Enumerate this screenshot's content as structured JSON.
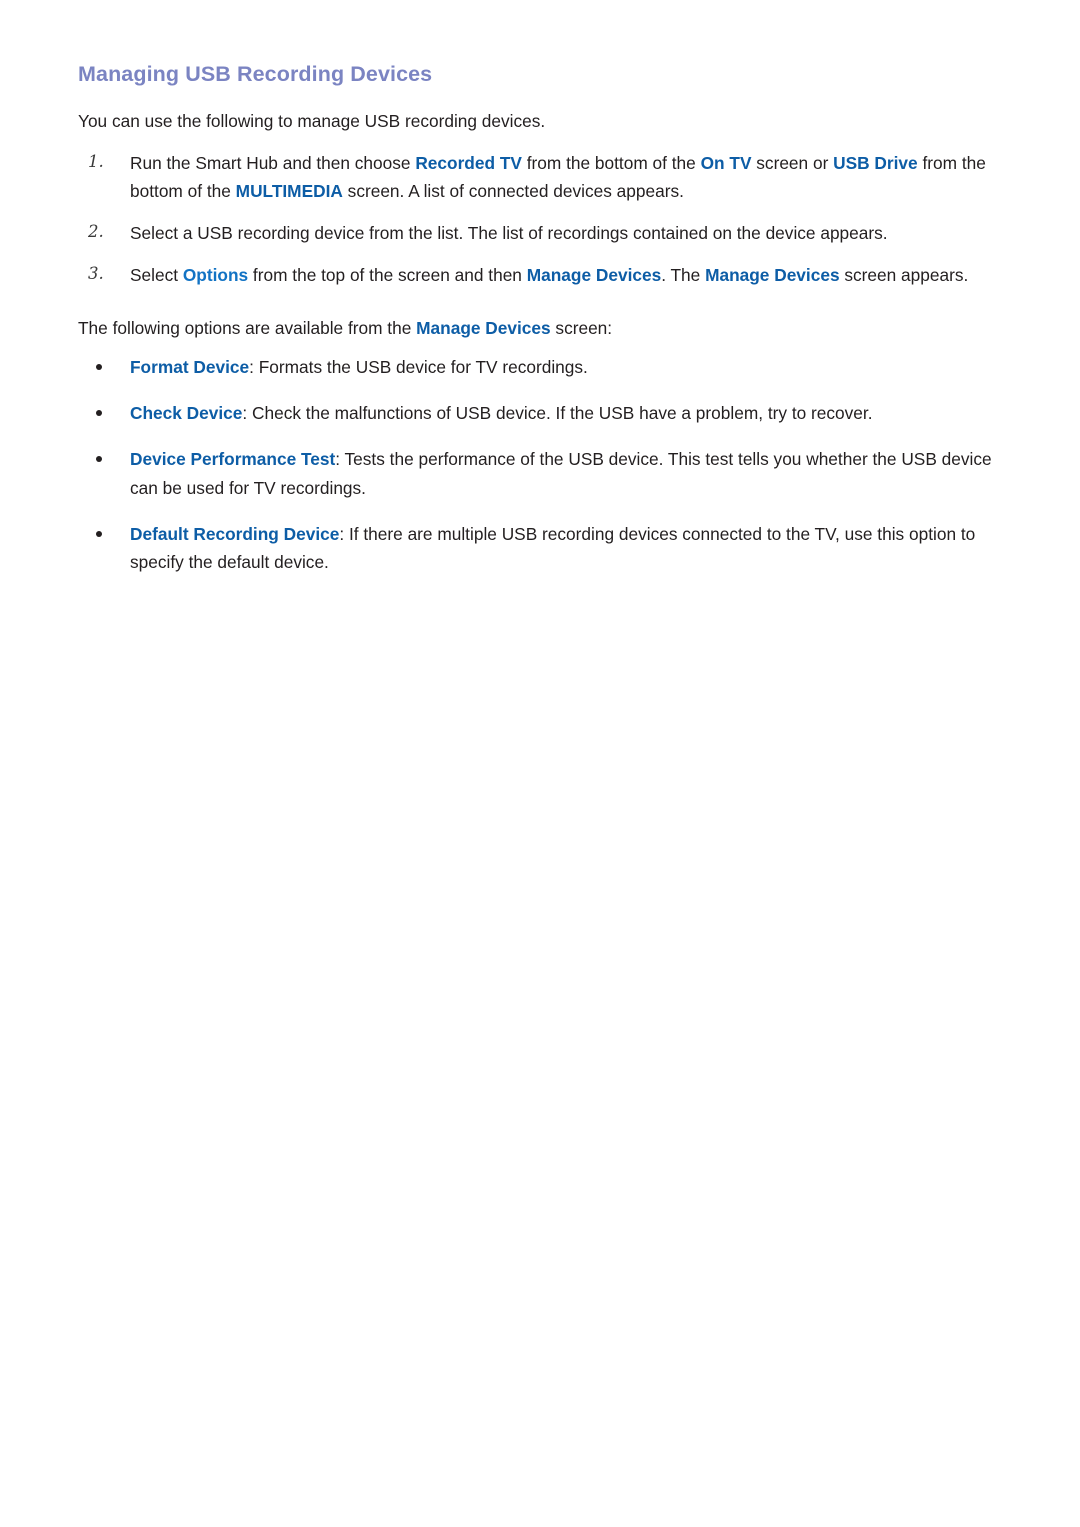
{
  "document": {
    "title": "Managing USB Recording Devices",
    "intro": "You can use the following to manage USB recording devices."
  },
  "steps": [
    {
      "marker": "1.",
      "segments": [
        {
          "text": "Run the Smart Hub and then choose ",
          "style": "plain"
        },
        {
          "text": "Recorded TV",
          "style": "highlight"
        },
        {
          "text": " from the bottom of the ",
          "style": "plain"
        },
        {
          "text": "On TV",
          "style": "highlight"
        },
        {
          "text": " screen or ",
          "style": "plain"
        },
        {
          "text": "USB Drive",
          "style": "highlight"
        },
        {
          "text": " from the bottom of the ",
          "style": "plain"
        },
        {
          "text": "MULTIMEDIA",
          "style": "highlight"
        },
        {
          "text": " screen. A list of connected devices appears.",
          "style": "plain"
        }
      ]
    },
    {
      "marker": "2.",
      "segments": [
        {
          "text": "Select a USB recording device from the list. The list of recordings contained on the device appears.",
          "style": "plain"
        }
      ]
    },
    {
      "marker": "3.",
      "segments": [
        {
          "text": "Select ",
          "style": "plain"
        },
        {
          "text": "Options",
          "style": "highlight-bright"
        },
        {
          "text": " from the top of the screen and then ",
          "style": "plain"
        },
        {
          "text": "Manage Devices",
          "style": "highlight"
        },
        {
          "text": ". The ",
          "style": "plain"
        },
        {
          "text": "Manage Devices",
          "style": "highlight"
        },
        {
          "text": " screen appears.",
          "style": "plain"
        }
      ]
    }
  ],
  "options_section": {
    "lead": [
      {
        "text": "The following options are available from the ",
        "style": "plain"
      },
      {
        "text": "Manage Devices",
        "style": "highlight"
      },
      {
        "text": " screen:",
        "style": "plain"
      }
    ],
    "items": [
      {
        "term": "Format Device",
        "separator": ": ",
        "description": "Formats the USB device for TV recordings."
      },
      {
        "term": "Check Device",
        "separator": ": ",
        "description": "Check the malfunctions of USB device. If the USB have a problem, try to recover."
      },
      {
        "term": "Device Performance Test",
        "separator": ": ",
        "description": "Tests the performance of the USB device. This test tells you whether the USB device can be used for TV recordings."
      },
      {
        "term": "Default Recording Device",
        "separator": ": ",
        "description": "If there are multiple USB recording devices connected to the TV, use this option to specify the default device."
      }
    ]
  },
  "colors": {
    "title": "#7b84c2",
    "highlight": "#0d5da6",
    "highlight_bright": "#1273c4",
    "body_text": "#231f20",
    "page_background": "#ffffff"
  }
}
